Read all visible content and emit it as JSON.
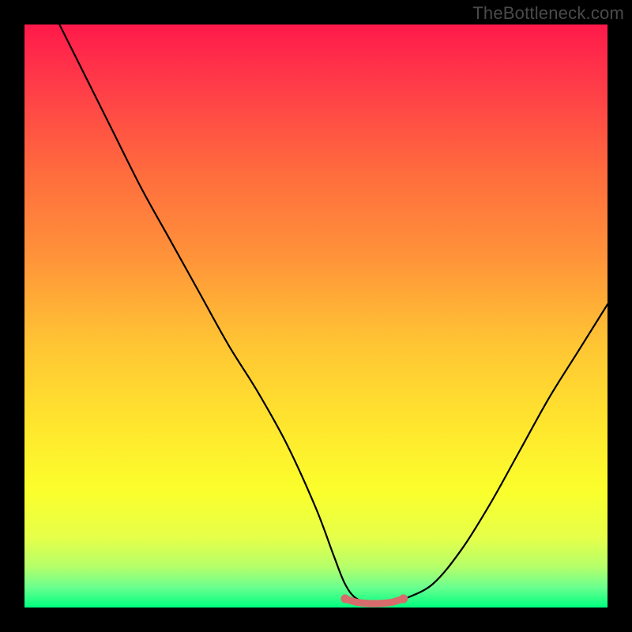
{
  "watermark": "TheBottleneck.com",
  "gradient_stops": [
    {
      "offset": 0.0,
      "color": "#ff1a4b"
    },
    {
      "offset": 0.1,
      "color": "#ff3b49"
    },
    {
      "offset": 0.25,
      "color": "#ff6b3e"
    },
    {
      "offset": 0.4,
      "color": "#ff943a"
    },
    {
      "offset": 0.55,
      "color": "#ffc634"
    },
    {
      "offset": 0.7,
      "color": "#ffe92e"
    },
    {
      "offset": 0.8,
      "color": "#fbff2c"
    },
    {
      "offset": 0.88,
      "color": "#e6ff4a"
    },
    {
      "offset": 0.93,
      "color": "#b6ff6a"
    },
    {
      "offset": 0.965,
      "color": "#6cff8f"
    },
    {
      "offset": 1.0,
      "color": "#00ff80"
    }
  ],
  "chart_data": {
    "type": "line",
    "title": "",
    "xlabel": "",
    "ylabel": "",
    "xlim": [
      0,
      100
    ],
    "ylim": [
      0,
      100
    ],
    "series": [
      {
        "name": "bottleneck-curve",
        "x": [
          6,
          10,
          15,
          20,
          25,
          30,
          35,
          40,
          45,
          50,
          53,
          55,
          57,
          60,
          63,
          65,
          70,
          75,
          80,
          85,
          90,
          95,
          100
        ],
        "y": [
          100,
          92,
          82,
          72,
          63,
          54,
          45,
          37,
          28,
          17,
          9,
          4,
          1.5,
          0.7,
          0.7,
          1.4,
          4,
          10,
          18,
          27,
          36,
          44,
          52
        ]
      },
      {
        "name": "flat-floor-highlight",
        "x": [
          55,
          57,
          59,
          61,
          63,
          65
        ],
        "y": [
          1.5,
          0.9,
          0.7,
          0.7,
          0.9,
          1.5
        ]
      }
    ]
  }
}
